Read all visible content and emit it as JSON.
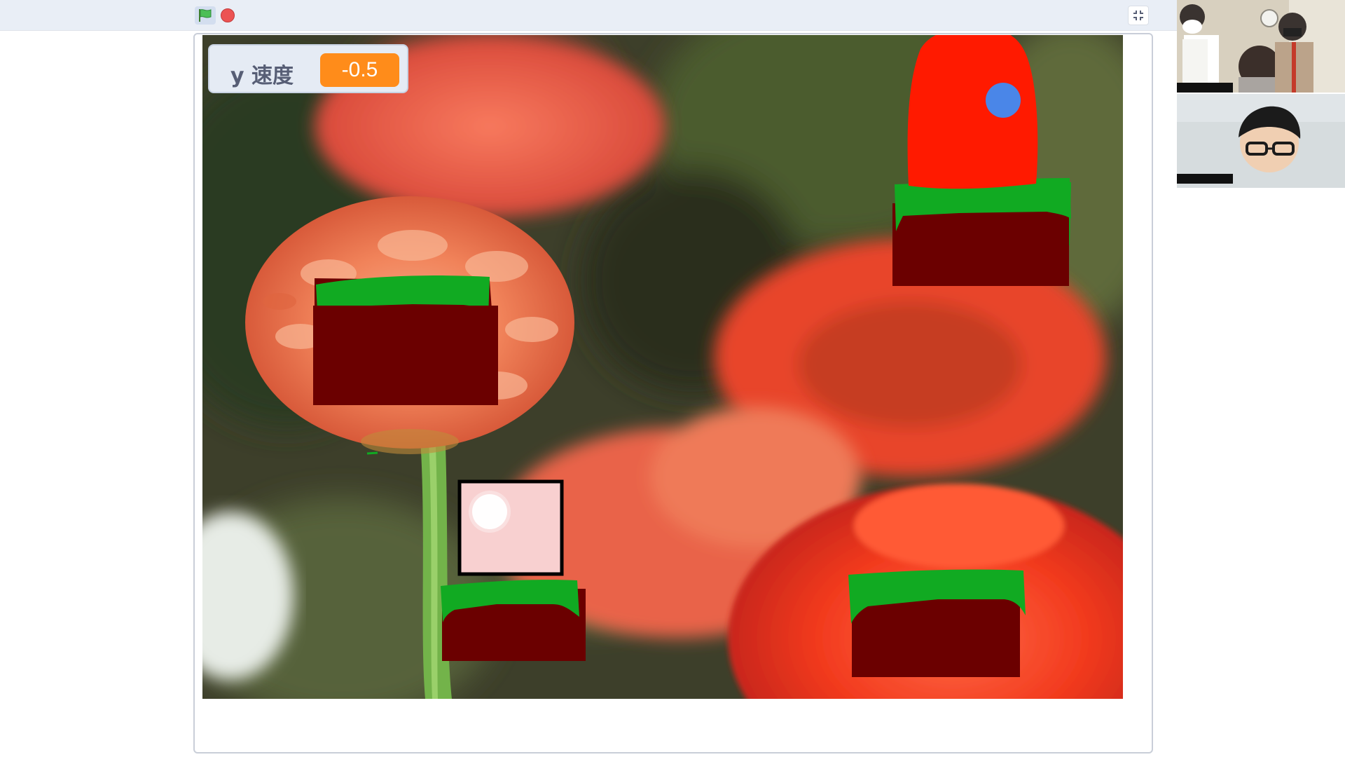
{
  "toolbar": {
    "green_flag_icon": "green-flag-icon",
    "stop_icon": "stop-icon",
    "fullscreen_icon": "exit-fullscreen-icon"
  },
  "stage": {
    "variable_monitor": {
      "label": "y 速度",
      "value": "-0.5"
    },
    "colors": {
      "grass": "#11aa22",
      "dirt": "#6b0000",
      "player": "#ff1a00",
      "player_eye": "#4a86e8",
      "goal_box": "#f8d0d0"
    }
  },
  "video_call": {
    "participants": [
      "participant-video-1",
      "participant-video-2"
    ]
  }
}
